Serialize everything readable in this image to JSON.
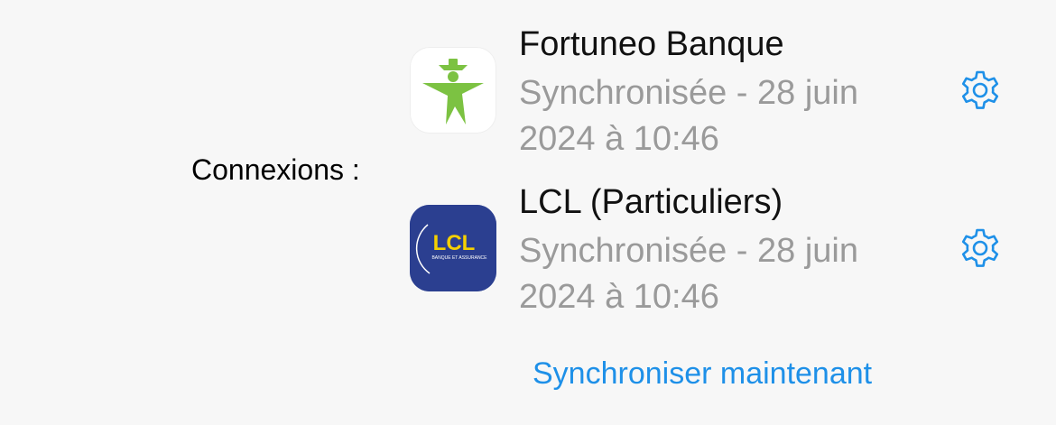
{
  "section": {
    "label": "Connexions :"
  },
  "connections": [
    {
      "name": "Fortuneo Banque",
      "status": "Synchronisée - 28 juin 2024 à 10:46",
      "logo_icon": "fortuneo-logo-icon",
      "settings_icon": "gear-icon"
    },
    {
      "name": "LCL (Particuliers)",
      "status": "Synchronisée - 28 juin 2024 à 10:46",
      "logo_icon": "lcl-logo-icon",
      "logo_text": "LCL",
      "logo_subtext": "BANQUE ET ASSURANCE",
      "settings_icon": "gear-icon"
    }
  ],
  "actions": {
    "sync_now_label": "Synchroniser maintenant"
  },
  "colors": {
    "accent": "#1e90e8",
    "status_text": "#9a9a9a",
    "fortuneo_green": "#7cc242",
    "lcl_blue": "#2b3f90",
    "lcl_yellow": "#f5d000"
  }
}
